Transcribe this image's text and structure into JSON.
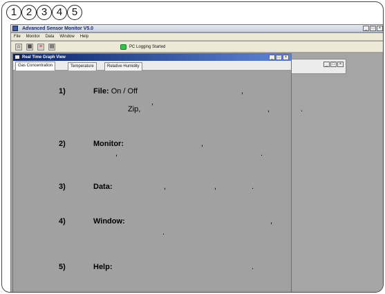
{
  "callouts": [
    "1",
    "2",
    "3",
    "4",
    "5"
  ],
  "app": {
    "title": "Advanced Sensor Monitor V5.0",
    "window_controls": [
      "_",
      "□",
      "×"
    ],
    "menu": [
      "File",
      "Monitor",
      "Data",
      "Window",
      "Help"
    ],
    "toolbar_icons": [
      "home-icon",
      "grid-icon",
      "red-plug-icon",
      "list-icon"
    ],
    "status_text": "PC Logging Started",
    "status_color": "#35c24a"
  },
  "graph_window": {
    "title": "Real Time Graph View",
    "tabs": [
      "Gas Concentration",
      "Temperature",
      "Relative Humidity"
    ]
  },
  "help": {
    "item1": {
      "num": "1)",
      "label": "File:",
      "text": "On / Off",
      "comma_a": ",",
      "comma_b": ",",
      "zip": "Zip,",
      "comma_c": ",",
      "period": "."
    },
    "item2": {
      "num": "2)",
      "label": "Monitor:",
      "comma_a": ",",
      "comma_b": ",",
      "period": "."
    },
    "item3": {
      "num": "3)",
      "label": "Data:",
      "comma_a": ",",
      "comma_b": ",",
      "period": "."
    },
    "item4": {
      "num": "4)",
      "label": "Window:",
      "comma_a": ",",
      "period": "."
    },
    "item5": {
      "num": "5)",
      "label": "Help:",
      "period": "."
    }
  }
}
